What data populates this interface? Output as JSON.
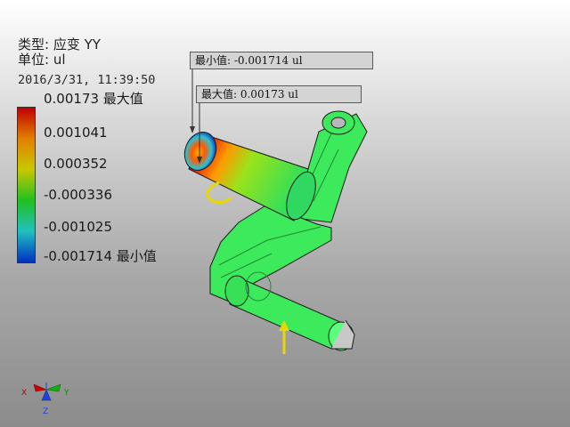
{
  "header": {
    "type_line": "类型: 应变 YY",
    "unit_line": "单位: ul",
    "timestamp": "2016/3/31, 11:39:50"
  },
  "legend": {
    "labels": [
      "0.00173 最大值",
      "0.001041",
      "0.000352",
      "-0.000336",
      "-0.001025",
      "-0.001714 最小值"
    ],
    "gradient_colors": [
      "#c00000",
      "#e08000",
      "#c8c800",
      "#20c020",
      "#20c0c0",
      "#0030c0"
    ]
  },
  "callouts": {
    "min_label": "最小值: -0.001714 ul",
    "max_label": "最大值: 0.00173 ul"
  },
  "triad": {
    "x_label": "X",
    "y_label": "Y",
    "z_label": "Z"
  },
  "colors": {
    "model_green": "#33e65a",
    "load_arrow": "#e8d800"
  }
}
